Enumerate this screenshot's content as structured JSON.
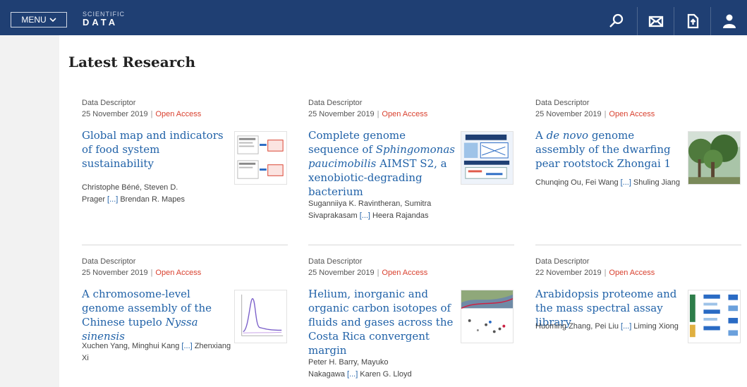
{
  "header": {
    "menu_label": "MENU",
    "logo_top": "SCIENTIFIC",
    "logo_bottom": "DATA",
    "icons": [
      "search-icon",
      "mail-icon",
      "submit-icon",
      "account-icon"
    ]
  },
  "page": {
    "heading": "Latest Research"
  },
  "articles": [
    {
      "type": "Data Descriptor",
      "date": "25 November 2019",
      "access": "Open Access",
      "title_parts": [
        {
          "t": "Global map and indicators of food system sustainability"
        }
      ],
      "authors_a": "Christophe Béné, Steven D. Prager",
      "authors_b": "Brendan R. Mapes",
      "thumb": "flow-diagram"
    },
    {
      "type": "Data Descriptor",
      "date": "25 November 2019",
      "access": "Open Access",
      "title_parts": [
        {
          "t": "Complete genome sequence of "
        },
        {
          "t": "Sphingomonas paucimobilis",
          "i": true
        },
        {
          "t": " AIMST S2, a xenobiotic-degrading bacterium"
        }
      ],
      "authors_a": "Suganniiya K. Ravintheran, Sumitra Sivaprakasam",
      "authors_b": "Heera Rajandas",
      "thumb": "pipeline-diagram"
    },
    {
      "type": "Data Descriptor",
      "date": "25 November 2019",
      "access": "Open Access",
      "title_parts": [
        {
          "t": "A "
        },
        {
          "t": "de novo",
          "i": true
        },
        {
          "t": " genome assembly of the dwarfing pear rootstock Zhongai 1"
        }
      ],
      "authors_a": "Chunqing Ou, Fei Wang",
      "authors_b": "Shuling Jiang",
      "thumb": "tree-photo"
    },
    {
      "type": "Data Descriptor",
      "date": "25 November 2019",
      "access": "Open Access",
      "title_parts": [
        {
          "t": "A chromosome-level genome assembly of the Chinese tupelo "
        },
        {
          "t": "Nyssa sinensis",
          "i": true
        }
      ],
      "authors_a": "Xuchen Yang, Minghui Kang",
      "authors_b": "Zhenxiang Xi",
      "thumb": "peak-plot"
    },
    {
      "type": "Data Descriptor",
      "date": "25 November 2019",
      "access": "Open Access",
      "title_parts": [
        {
          "t": "Helium, inorganic and organic carbon isotopes of fluids and gases across the Costa Rica convergent margin"
        }
      ],
      "authors_a": "Peter H. Barry, Mayuko Nakagawa",
      "authors_b": "Karen G. Lloyd",
      "thumb": "map-scatter"
    },
    {
      "type": "Data Descriptor",
      "date": "22 November 2019",
      "access": "Open Access",
      "title_parts": [
        {
          "t": "Arabidopsis proteome and the mass spectral assay library"
        }
      ],
      "authors_a": "Huoming Zhang, Pei Liu",
      "authors_b": "Liming Xiong",
      "thumb": "workflow-diagram"
    }
  ],
  "ellipsis": "[...]",
  "separator": "|"
}
